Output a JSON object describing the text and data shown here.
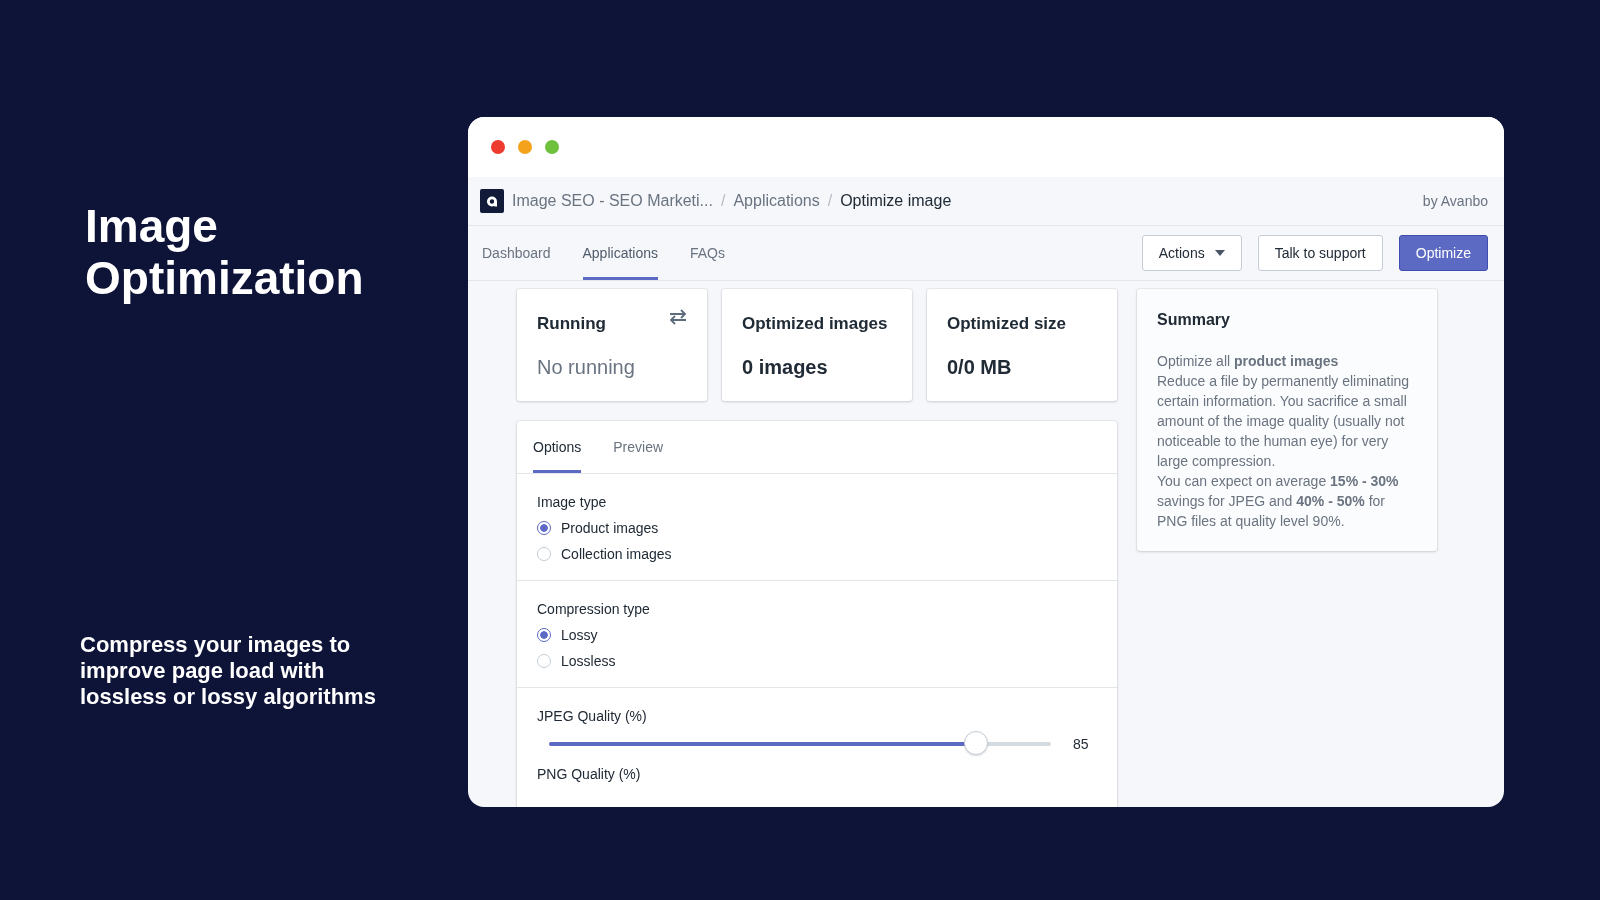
{
  "promo": {
    "title": "Image Optimization",
    "subtitle": "Compress your images to improve page load with lossless or lossy algorithms"
  },
  "breadcrumb": [
    {
      "label": "Image SEO - SEO Marketi..."
    },
    {
      "separator": "/",
      "label": "Applications"
    },
    {
      "separator": "/",
      "label": "Optimize image"
    }
  ],
  "byline": "by Avanbo",
  "nav_tabs": [
    {
      "label": "Dashboard",
      "selected": false
    },
    {
      "label": "Applications",
      "selected": true
    },
    {
      "label": "FAQs",
      "selected": false
    }
  ],
  "actions": {
    "dropdown": "Actions",
    "secondary": "Talk to support",
    "primary": "Optimize"
  },
  "stats": [
    {
      "title": "Running",
      "value": "No running",
      "muted": true,
      "kind": "sync"
    },
    {
      "title": "Optimized images",
      "value": "0 images",
      "muted": false,
      "kind": "plain"
    },
    {
      "title": "Optimized size",
      "value": "0/0 MB",
      "muted": false,
      "kind": "plain"
    }
  ],
  "option_tabs": [
    {
      "label": "Options",
      "selected": true
    },
    {
      "label": "Preview",
      "selected": false
    }
  ],
  "groups": [
    {
      "label": "Image type",
      "options": [
        {
          "label": "Product images",
          "selected": true
        },
        {
          "label": "Collection images",
          "selected": false
        }
      ]
    },
    {
      "label": "Compression type",
      "options": [
        {
          "label": "Lossy",
          "selected": true
        },
        {
          "label": "Lossless",
          "selected": false
        }
      ]
    }
  ],
  "sliders": [
    {
      "label": "JPEG Quality (%)",
      "level": 0.85,
      "reading": "85"
    }
  ],
  "next_label": "PNG Quality (%)",
  "summary": {
    "title": "Summary",
    "paragraphs": [
      "Optimize all **product images**",
      "Reduce a file by permanently eliminating certain information. You sacrifice a small amount of the image quality (usually not noticeable to the human eye) for very large compression.",
      "You can expect on average **15% - 30%** savings for JPEG and **40% - 50%** for PNG files at quality level 90%."
    ]
  }
}
